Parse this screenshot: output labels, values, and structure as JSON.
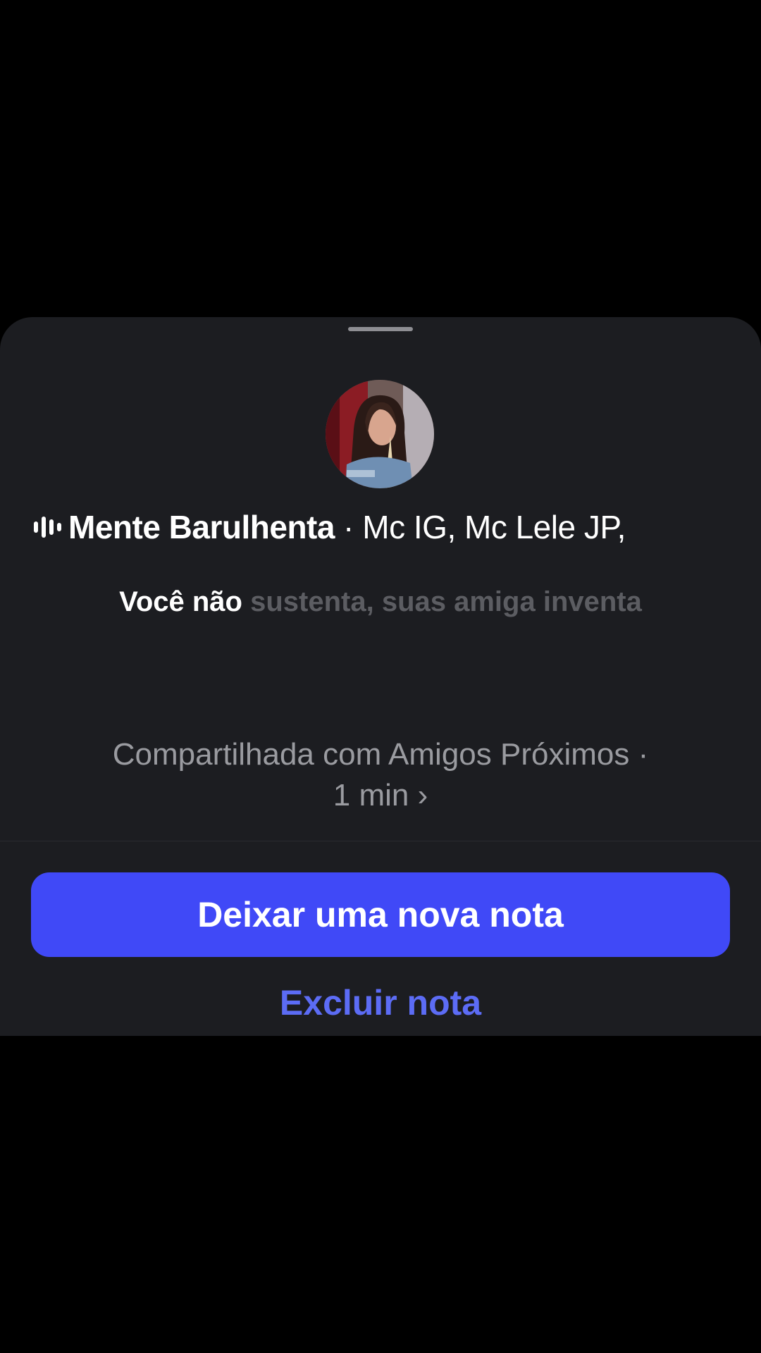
{
  "note_sheet": {
    "song": {
      "title": "Mente Barulhenta",
      "separator": "·",
      "artists": "Mc IG, Mc Lele JP,"
    },
    "lyrics": {
      "sung": "Você não",
      "upcoming": "sustenta, suas amiga inventa"
    },
    "shared": {
      "line1": "Compartilhada com Amigos Próximos ·",
      "line2": "1 min ›"
    },
    "primary_action": "Deixar uma nova nota",
    "secondary_action": "Excluir nota"
  },
  "colors": {
    "background": "#000000",
    "sheet": "#1c1d21",
    "primary_button": "#4049f7",
    "link": "#5c6cf5",
    "muted_text": "#9a9ba0",
    "unsung_lyric": "#5c5d62"
  },
  "icons": {
    "grabber": "drag-handle",
    "song": "audio-equalizer-icon"
  }
}
